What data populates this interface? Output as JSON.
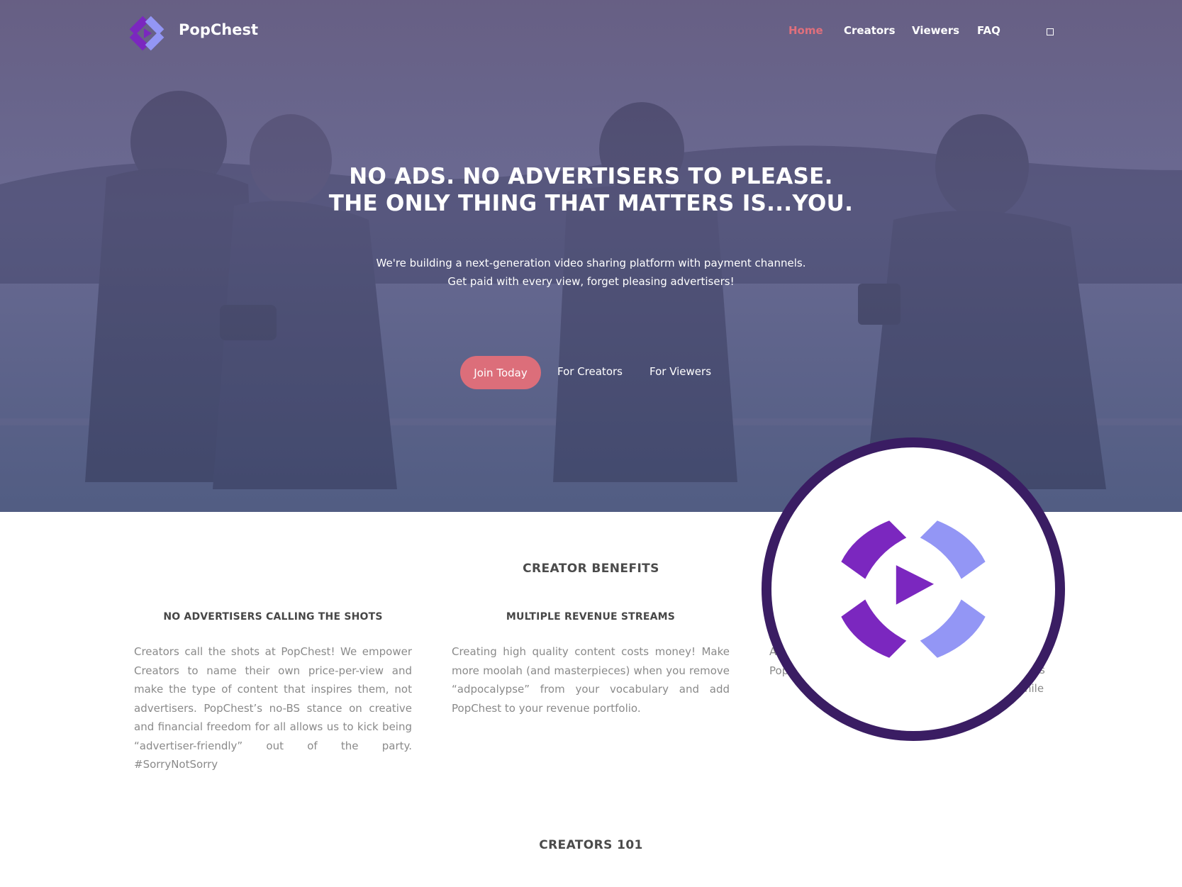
{
  "brand": {
    "name": "PopChest"
  },
  "nav": {
    "items": [
      {
        "label": "Home",
        "active": true
      },
      {
        "label": "Creators",
        "active": false
      },
      {
        "label": "Viewers",
        "active": false
      },
      {
        "label": "FAQ",
        "active": false
      }
    ],
    "toggle_icon": "square-icon"
  },
  "hero": {
    "headline_line1": "NO ADS. NO ADVERTISERS TO PLEASE.",
    "headline_line2": "THE ONLY THING THAT MATTERS IS...YOU.",
    "sub_line1": "We're building a next-generation video sharing platform with payment channels.",
    "sub_line2": "Get paid with every view, forget pleasing advertisers!",
    "join_label": "Join Today",
    "creators_link": "For Creators",
    "viewers_link": "For Viewers"
  },
  "colors": {
    "accent": "#dc6e7a",
    "logo_purple": "#7b27bf",
    "logo_lavender": "#9396f5",
    "badge_ring": "#3a1d63"
  },
  "benefits": {
    "title": "CREATOR BENEFITS",
    "columns": [
      {
        "title": "NO ADVERTISERS CALLING THE SHOTS",
        "text": "Creators call the shots at PopChest! We empower Creators to name their own price-per-view and make the type of content that inspires them, not advertisers. PopChest’s no-BS stance on creative and financial freedom for all allows us to kick being “advertiser-friendly” out of the party. #SorryNotSorry"
      },
      {
        "title": "MULTIPLE REVENUE STREAMS",
        "text": "Creating high quality content costs money! Make more moolah (and masterpieces) when you remove “adpocalypse” from your vocabulary and add PopChest to your revenue portfolio."
      },
      {
        "title": "",
        "text": "A tra here, PopChest"
      }
    ],
    "partial_right_fragments": [
      "s",
      "hile"
    ]
  },
  "creators101": {
    "title": "CREATORS 101"
  }
}
